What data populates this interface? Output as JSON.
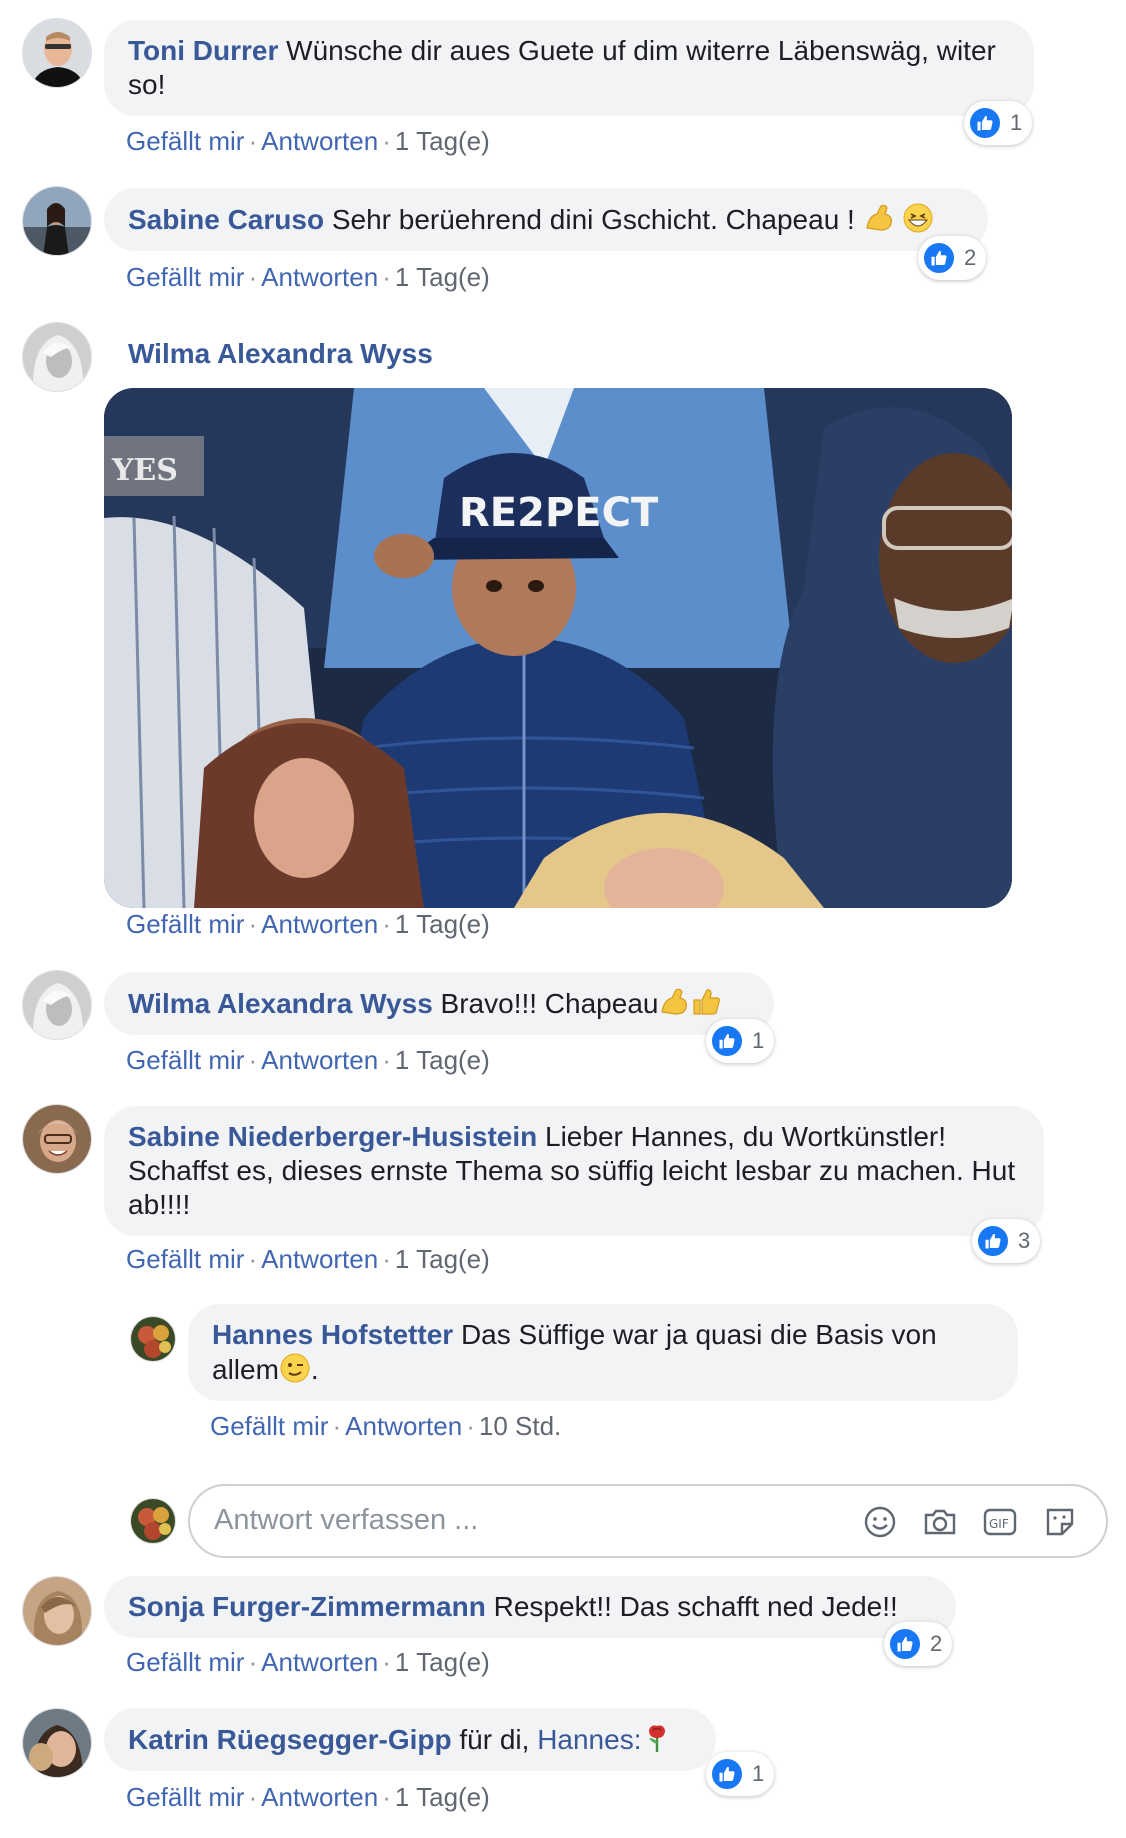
{
  "actions": {
    "like": "Gefällt mir",
    "reply": "Antworten"
  },
  "comments": [
    {
      "author": "Toni Durrer",
      "text": "Wünsche dir aues Guete uf dim witerre Läbenswäg, witer so!",
      "time": "1 Tag(e)",
      "likes": "1"
    },
    {
      "author": "Sabine Caruso",
      "text": "Sehr berüehrend dini Gschicht. Chapeau !",
      "time": "1 Tag(e)",
      "likes": "2",
      "emoji": [
        "flexed-biceps-icon",
        "grinning-face-icon"
      ]
    },
    {
      "author": "Wilma Alexandra Wyss",
      "text": "",
      "time": "1 Tag(e)",
      "media": {
        "cap_text": "RE2PECT",
        "sign_text": "YES"
      }
    },
    {
      "author": "Wilma Alexandra Wyss",
      "text": "Bravo!!! Chapeau",
      "time": "1 Tag(e)",
      "likes": "1",
      "emoji": [
        "flexed-biceps-icon",
        "thumbs-up-icon"
      ]
    },
    {
      "author": "Sabine Niederberger-Husistein",
      "text": "Lieber Hannes, du Wortkünstler! Schaffst es, dieses ernste Thema so süffig leicht lesbar zu machen. Hut ab!!!!",
      "time": "1 Tag(e)",
      "likes": "3"
    },
    {
      "author": "Sonja Furger-Zimmermann",
      "text": "Respekt!! Das schafft ned Jede!!",
      "time": "1 Tag(e)",
      "likes": "2"
    },
    {
      "author": "Katrin Rüegsegger-Gipp",
      "text": "für di,",
      "mention": "Hannes:",
      "time": "1 Tag(e)",
      "likes": "1",
      "emoji": [
        "rose-icon"
      ]
    }
  ],
  "reply": {
    "author": "Hannes Hofstetter",
    "text_a": "Das Süffige war ja quasi die Basis von allem",
    "text_b": ".",
    "time": "10 Std.",
    "emoji": [
      "winking-face-icon"
    ]
  },
  "composer": {
    "placeholder": "Antwort verfassen ...",
    "icons": [
      "smiley-icon",
      "camera-icon",
      "gif-icon",
      "sticker-icon"
    ],
    "gif_label": "GIF"
  },
  "colors": {
    "author": "#385898",
    "action": "#4267b2",
    "bubble": "#f2f3f5",
    "like": "#1877f2"
  }
}
